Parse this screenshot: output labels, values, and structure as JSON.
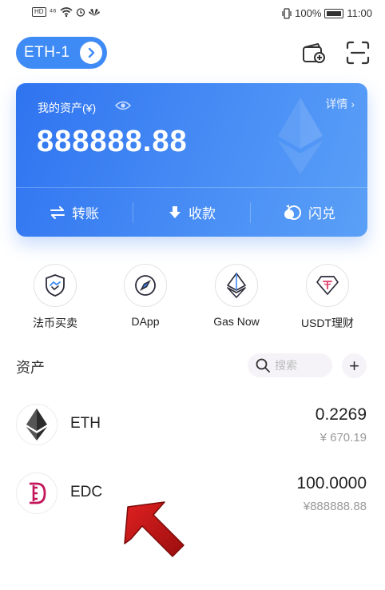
{
  "status_bar": {
    "left": "HD ⁴⁶",
    "battery": "100%",
    "time": "11:00"
  },
  "header": {
    "wallet_name": "ETH-1",
    "icons": [
      "add-wallet-icon",
      "scan-icon"
    ]
  },
  "asset_card": {
    "label": "我的资产(¥)",
    "details": "详情 ›",
    "amount": "888888.88",
    "actions": [
      {
        "label": "转账",
        "icon": "transfer-icon"
      },
      {
        "label": "收款",
        "icon": "receive-icon"
      },
      {
        "label": "闪兑",
        "icon": "swap-icon"
      }
    ],
    "accent": "#3f8bf5"
  },
  "quick_actions": [
    {
      "label": "法币买卖",
      "icon": "handshake-shield-icon"
    },
    {
      "label": "DApp",
      "icon": "compass-icon"
    },
    {
      "label": "Gas Now",
      "icon": "ethereum-icon"
    },
    {
      "label": "USDT理财",
      "icon": "tether-diamond-icon"
    }
  ],
  "assets": {
    "title": "资产",
    "search_placeholder": "搜索",
    "add_label": "+",
    "tokens": [
      {
        "symbol": "ETH",
        "amount": "0.2269",
        "value": "¥ 670.19",
        "icon": "ethereum-icon"
      },
      {
        "symbol": "EDC",
        "amount": "100.0000",
        "value": "¥888888.88",
        "icon": "edc-logo-icon"
      }
    ]
  }
}
